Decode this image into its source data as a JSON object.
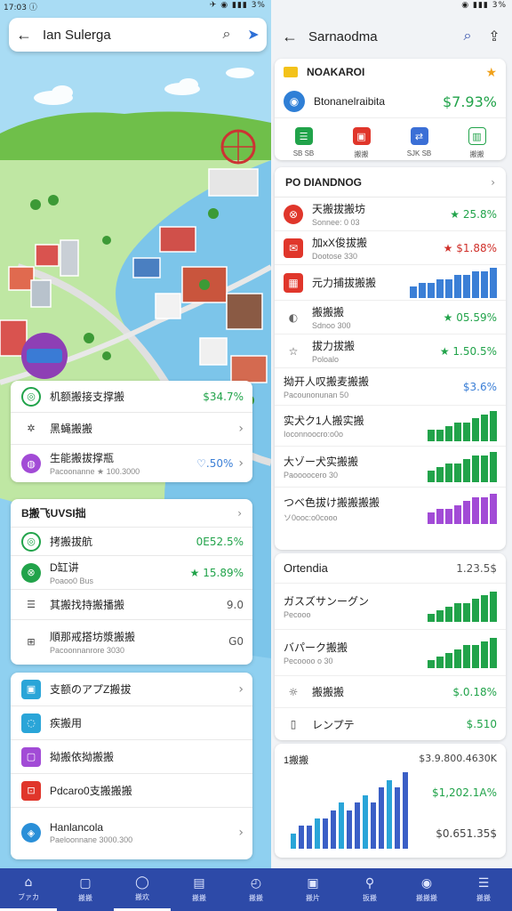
{
  "left": {
    "status": {
      "time": "17:03 ⓘ",
      "icons": "✈ ◉ ▮▮▮ 3%"
    },
    "topbar": {
      "title": "Ian Sulerga"
    },
    "card1": {
      "rows": [
        {
          "label": "机额搬接支撑搬",
          "value": "$34.7%",
          "icon": "◎"
        },
        {
          "label": "黑蝇搬搬",
          "value": "›",
          "icon": "✲"
        },
        {
          "label": "生能搬拔撑瓶",
          "sub": "Pacoonanne ★ 100.3000",
          "value": "♡.50%",
          "icon": "◍"
        }
      ]
    },
    "card2": {
      "header": "B搬飞UVSI拙",
      "rows": [
        {
          "label": "拷搬拔航",
          "value": "0E52.5%",
          "icon": "◎"
        },
        {
          "label": "D缸讲",
          "sub": "Poaoo0 Bus",
          "value": "★ 15.89%",
          "icon": "⊗"
        },
        {
          "label": "其搬找持搬播搬",
          "value": "9.0",
          "icon": "☰"
        },
        {
          "label": "順那戒搭坊漿搬搬",
          "sub": "Pacoonnanrore 3030",
          "value": "G0",
          "icon": "⊞"
        }
      ]
    },
    "card3": {
      "rows": [
        {
          "label": "支额のアプZ搬拔",
          "icon": "▣"
        },
        {
          "label": "疾搬用",
          "icon": "◌"
        },
        {
          "label": "拗搬依拗搬搬",
          "icon": "▢"
        },
        {
          "label": "Pdcaro0支搬搬搬",
          "icon": "⊡"
        },
        {
          "label": "Hanlancola",
          "sub": "Paeloonnane 3000.300",
          "icon": "◈"
        }
      ]
    }
  },
  "right": {
    "status": {
      "time": "",
      "icons": "◉ ▮▮▮ 3%"
    },
    "topbar": {
      "title": "Sarnaodma"
    },
    "header": {
      "title": "NOAKAROI",
      "name": "Btonanelraibita",
      "amount": "$7.93%",
      "quick": [
        "SB SB",
        "搬搬",
        "SJK SB",
        "搬搬"
      ]
    },
    "watch": {
      "header": "PO DIANDNOG",
      "rows": [
        {
          "label": "天搬拔搬坊",
          "sub": "Sonnee: 0 03",
          "value": "★ 25.8%",
          "icon": "⊗"
        },
        {
          "label": "加xX俊拔搬",
          "sub": "Dootose 330",
          "value": "★ $1.88%",
          "icon": "✉"
        },
        {
          "label": "元力捕拔搬搬",
          "sub": "",
          "value": "",
          "icon": "▦"
        },
        {
          "label": "搬搬搬",
          "sub": "Sdnoo 300",
          "value": "★ 05.59%",
          "icon": "◐"
        },
        {
          "label": "拔力拔搬",
          "sub": "Poloalo",
          "value": "★ 1.50.5%",
          "icon": "☆"
        },
        {
          "label": "拗开人叹搬麦搬搬",
          "sub": "Pacounonunan 50",
          "value": "$3.6%",
          "icon": ""
        },
        {
          "label": "实犬ク1人搬实搬",
          "sub": "Ioconnoocro:o0o",
          "value": "",
          "icon": ""
        },
        {
          "label": "大ゾー犬实搬搬",
          "sub": "Paoooocero 30",
          "value": "",
          "icon": ""
        },
        {
          "label": "つベ色拔け搬搬搬搬",
          "sub": "ソ0ooc:o0cooo",
          "value": "",
          "icon": ""
        }
      ]
    },
    "ortho": {
      "header": "Ortendia",
      "header_value": "1.23.5$",
      "rows": [
        {
          "label": "ガスズサンーグン",
          "sub": "Pecooo",
          "value": "",
          "icon": ""
        },
        {
          "label": "バパーク搬搬",
          "sub": "Pecoooo o 30",
          "value": "",
          "icon": ""
        },
        {
          "label": "搬搬搬",
          "value": "$.0.18%",
          "icon": "☼"
        },
        {
          "label": "レンプテ",
          "value": "$.510",
          "icon": "▯"
        }
      ]
    },
    "bars": {
      "label": "1搬搬",
      "values": [
        "$3.9.800.4630K",
        "$1,202.1A%",
        "$0.651.35$"
      ]
    }
  },
  "nav": [
    {
      "label": "ブァカ",
      "icon": "⌂"
    },
    {
      "label": "搬搬",
      "icon": "▢"
    },
    {
      "label": "搬欢",
      "icon": "◯"
    },
    {
      "label": "搬搬",
      "icon": "▤"
    },
    {
      "label": "搬搬",
      "icon": "◴"
    },
    {
      "label": "搬片",
      "icon": "▣"
    },
    {
      "label": "扳搬",
      "icon": "⚲"
    },
    {
      "label": "搬搬搬",
      "icon": "◉"
    },
    {
      "label": "搬搬",
      "icon": "☰"
    }
  ],
  "colors": {
    "green": "#21a34a",
    "blue": "#3b7fd6",
    "purple": "#a24bd6",
    "nav": "#2d4aa8"
  },
  "chart_data": {
    "type": "bar",
    "spark_series": [
      {
        "values": [
          3,
          4,
          4,
          5,
          5,
          6,
          6,
          7,
          7,
          8
        ]
      },
      {
        "values": [
          3,
          3,
          4,
          5,
          5,
          6,
          7,
          8
        ]
      },
      {
        "values": [
          3,
          4,
          5,
          5,
          6,
          7,
          7,
          8
        ]
      },
      {
        "values": [
          3,
          4,
          4,
          5,
          6,
          7,
          7,
          8
        ]
      },
      {
        "values": [
          2,
          3,
          4,
          5,
          5,
          6,
          7,
          8
        ]
      },
      {
        "values": [
          2,
          3,
          4,
          5,
          6,
          6,
          7,
          8
        ]
      },
      {
        "values": [
          3,
          2,
          5,
          5,
          6,
          6,
          7,
          8
        ]
      }
    ],
    "bottom_bars": [
      2,
      3,
      3,
      4,
      4,
      5,
      6,
      5,
      6,
      7,
      6,
      8,
      9,
      8,
      10
    ]
  }
}
